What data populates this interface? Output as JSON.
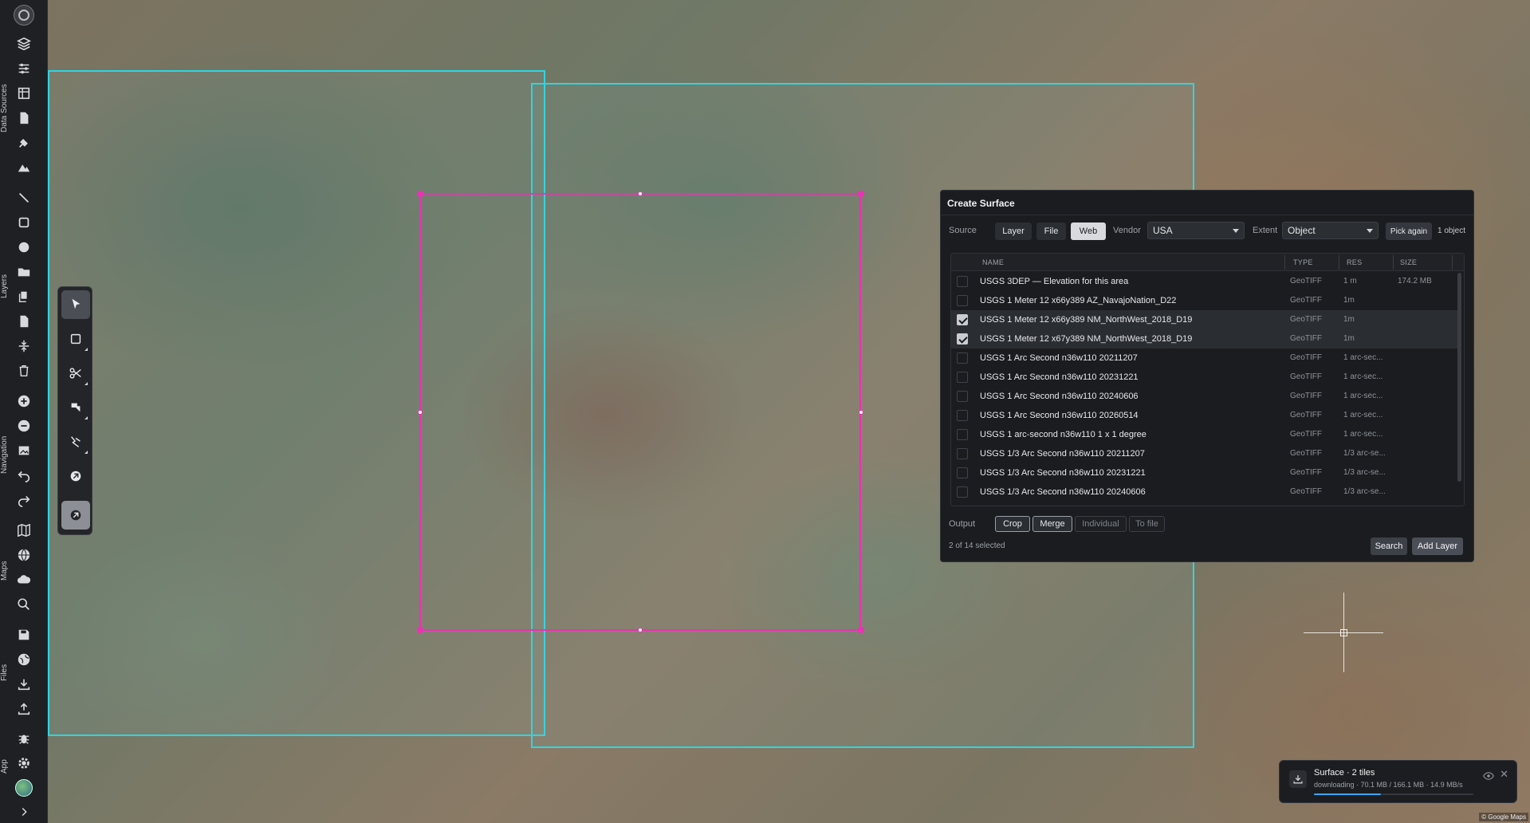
{
  "sidebar": {
    "sections": [
      "Data Sources",
      "Layers",
      "Navigation",
      "Maps",
      "Files",
      "App"
    ],
    "icons": {
      "logo": "app-logo",
      "data_sources": [
        "layers-stack-icon",
        "sliders-icon",
        "table-icon",
        "document-icon",
        "satellite-icon",
        "mountain-icon"
      ],
      "layers": [
        "line-icon",
        "square-icon",
        "circle-icon",
        "folder-icon",
        "copy-icon",
        "file-icon",
        "split-icon",
        "trash-icon"
      ],
      "navigation": [
        "zoom-in-icon",
        "zoom-out-icon",
        "image-icon",
        "undo-icon",
        "redo-icon"
      ],
      "maps": [
        "map-icon",
        "globe-icon",
        "cloud-icon",
        "search-icon"
      ],
      "files": [
        "save-icon",
        "web-icon",
        "download-icon",
        "upload-icon"
      ],
      "app": [
        "bug-icon",
        "gear-icon",
        "avatar",
        "chevron-right-icon"
      ]
    }
  },
  "tools": [
    "pointer-icon",
    "rectangle-icon",
    "scissors-icon",
    "rotate-icon",
    "magnet-icon",
    "drone-icon",
    "surface-tool-icon"
  ],
  "panel": {
    "title": "Create Surface",
    "source_label": "Source",
    "source_options": [
      "Layer",
      "File",
      "Web"
    ],
    "source_selected": "Web",
    "vendor_label": "Vendor",
    "vendor_value": "USA",
    "extent_label": "Extent",
    "extent_value": "Object",
    "pick_again": "Pick again",
    "object_count": "1 object",
    "columns": [
      "NAME",
      "TYPE",
      "RES",
      "SIZE"
    ],
    "rows": [
      {
        "name": "USGS 3DEP — Elevation for this area",
        "type": "GeoTIFF",
        "res": "1 m",
        "size": "174.2 MB",
        "checked": false
      },
      {
        "name": "USGS 1 Meter 12 x66y389 AZ_NavajoNation_D22",
        "type": "GeoTIFF",
        "res": "1m",
        "size": "",
        "checked": false
      },
      {
        "name": "USGS 1 Meter 12 x66y389 NM_NorthWest_2018_D19",
        "type": "GeoTIFF",
        "res": "1m",
        "size": "",
        "checked": true
      },
      {
        "name": "USGS 1 Meter 12 x67y389 NM_NorthWest_2018_D19",
        "type": "GeoTIFF",
        "res": "1m",
        "size": "",
        "checked": true
      },
      {
        "name": "USGS 1 Arc Second n36w110 20211207",
        "type": "GeoTIFF",
        "res": "1 arc-sec...",
        "size": "",
        "checked": false
      },
      {
        "name": "USGS 1 Arc Second n36w110 20231221",
        "type": "GeoTIFF",
        "res": "1 arc-sec...",
        "size": "",
        "checked": false
      },
      {
        "name": "USGS 1 Arc Second n36w110 20240606",
        "type": "GeoTIFF",
        "res": "1 arc-sec...",
        "size": "",
        "checked": false
      },
      {
        "name": "USGS 1 Arc Second n36w110 20260514",
        "type": "GeoTIFF",
        "res": "1 arc-sec...",
        "size": "",
        "checked": false
      },
      {
        "name": "USGS 1 arc-second n36w110 1 x 1 degree",
        "type": "GeoTIFF",
        "res": "1 arc-sec...",
        "size": "",
        "checked": false
      },
      {
        "name": "USGS 1/3 Arc Second n36w110 20211207",
        "type": "GeoTIFF",
        "res": "1/3 arc-se...",
        "size": "",
        "checked": false
      },
      {
        "name": "USGS 1/3 Arc Second n36w110 20231221",
        "type": "GeoTIFF",
        "res": "1/3 arc-se...",
        "size": "",
        "checked": false
      },
      {
        "name": "USGS 1/3 Arc Second n36w110 20240606",
        "type": "GeoTIFF",
        "res": "1/3 arc-se...",
        "size": "",
        "checked": false
      }
    ],
    "output_label": "Output",
    "output_options": [
      "Crop",
      "Merge",
      "Individual",
      "To file"
    ],
    "output_active": [
      "Crop",
      "Merge"
    ],
    "selection_status": "2 of 14 selected",
    "search_button": "Search",
    "add_layer_button": "Add Layer"
  },
  "toast": {
    "title": "Surface · 2 tiles",
    "status": "downloading · 70.1 MB / 166.1 MB · 14.9 MB/s",
    "progress": 0.42
  },
  "map": {
    "attribution": "© Google Maps",
    "tile_color": "#2fd5e0",
    "selection_color": "#ee2fb8"
  }
}
